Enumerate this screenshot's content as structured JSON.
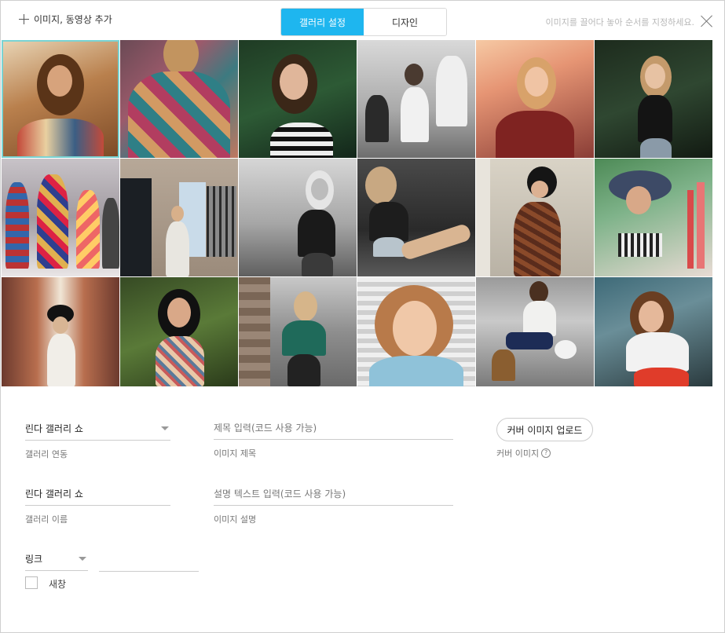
{
  "header": {
    "add_label": "이미지, 동영상 추가",
    "tabs": [
      {
        "label": "갤러리 설정",
        "active": true
      },
      {
        "label": "디자인",
        "active": false
      }
    ],
    "hint": "이미지를 끌어다 놓아 순서를 지정하세요."
  },
  "colors": {
    "accent": "#1eb6ef",
    "selected_border": "#79d3d3"
  },
  "gallery": {
    "selected_index": 0,
    "count": 18
  },
  "form": {
    "gallery_link": {
      "value": "린다 갤러리 쇼",
      "label": "갤러리 연동"
    },
    "gallery_name": {
      "value": "린다 갤러리 쇼",
      "label": "갤러리 이름"
    },
    "link": {
      "value": "링크",
      "new_window_label": "새창"
    },
    "image_title": {
      "placeholder": "제목 입력(코드 사용 가능)",
      "label": "이미지 제목"
    },
    "image_desc": {
      "placeholder": "설명 텍스트 입력(코드 사용 가능)",
      "label": "이미지 설명"
    },
    "cover": {
      "button_label": "커버 이미지 업로드",
      "label": "커버 이미지",
      "help_glyph": "?"
    }
  }
}
